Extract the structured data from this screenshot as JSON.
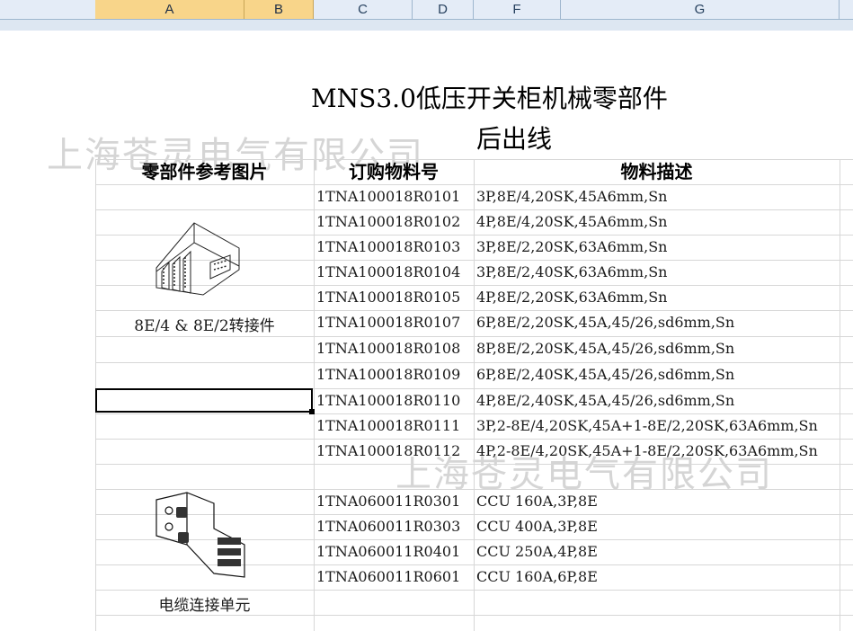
{
  "columns": [
    {
      "label": "A",
      "selected": true
    },
    {
      "label": "B",
      "selected": true
    },
    {
      "label": "C",
      "selected": false
    },
    {
      "label": "D",
      "selected": false
    },
    {
      "label": "F",
      "selected": false
    },
    {
      "label": "G",
      "selected": false
    }
  ],
  "title": {
    "line1": "MNS3.0低压开关柜机械零部件",
    "line2": "后出线"
  },
  "watermark": "上海苍灵电气有限公司",
  "headers": {
    "image": "零部件参考图片",
    "order_no": "订购物料号",
    "desc": "物料描述"
  },
  "group1": {
    "caption": "8E/4 & 8E/2转接件",
    "image_icon": "adapter-part-image",
    "rows": [
      {
        "code": "1TNA100018R0101",
        "desc": "3P,8E/4,20SK,45A6mm,Sn"
      },
      {
        "code": "1TNA100018R0102",
        "desc": "4P,8E/4,20SK,45A6mm,Sn"
      },
      {
        "code": "1TNA100018R0103",
        "desc": "3P,8E/2,20SK,63A6mm,Sn"
      },
      {
        "code": "1TNA100018R0104",
        "desc": "3P,8E/2,40SK,63A6mm,Sn"
      },
      {
        "code": "1TNA100018R0105",
        "desc": "4P,8E/2,20SK,63A6mm,Sn"
      },
      {
        "code": "1TNA100018R0107",
        "desc": "6P,8E/2,20SK,45A,45/26,sd6mm,Sn"
      },
      {
        "code": "1TNA100018R0108",
        "desc": "8P,8E/2,20SK,45A,45/26,sd6mm,Sn"
      },
      {
        "code": "1TNA100018R0109",
        "desc": "6P,8E/2,40SK,45A,45/26,sd6mm,Sn"
      },
      {
        "code": "1TNA100018R0110",
        "desc": "4P,8E/2,40SK,45A,45/26,sd6mm,Sn"
      },
      {
        "code": "1TNA100018R0111",
        "desc": "3P,2-8E/4,20SK,45A+1-8E/2,20SK,63A6mm,Sn"
      },
      {
        "code": "1TNA100018R0112",
        "desc": "4P,2-8E/4,20SK,45A+1-8E/2,20SK,63A6mm,Sn"
      }
    ]
  },
  "group2": {
    "caption": "电缆连接单元",
    "image_icon": "cable-connection-unit-image",
    "rows": [
      {
        "code": "1TNA060011R0301",
        "desc": "CCU 160A,3P,8E"
      },
      {
        "code": "1TNA060011R0303",
        "desc": "CCU 400A,3P,8E"
      },
      {
        "code": "1TNA060011R0401",
        "desc": "CCU 250A,4P,8E"
      },
      {
        "code": "1TNA060011R0601",
        "desc": "CCU 160A,6P,8E"
      }
    ]
  },
  "colors": {
    "header_bg": "#e4ecf7",
    "selected_col": "#f8d58a",
    "grid": "#d7d7d7"
  }
}
